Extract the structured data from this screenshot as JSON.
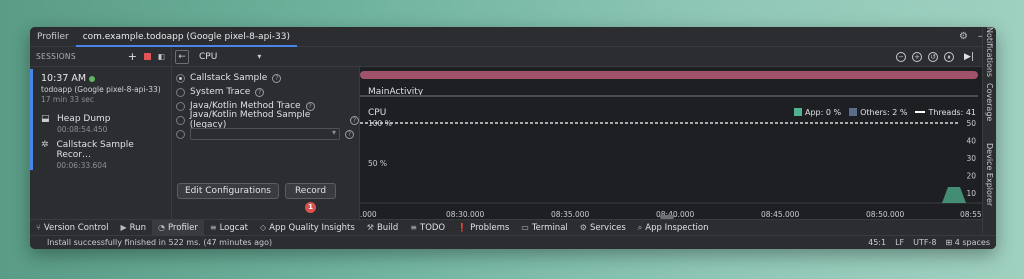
{
  "window": {
    "tabs": [
      "Profiler",
      "com.example.todoapp (Google pixel-8-api-33)"
    ],
    "right_icons": [
      "gear-icon",
      "minimize-icon"
    ]
  },
  "right_strip": [
    "Notifications",
    "Coverage",
    "Device Explorer"
  ],
  "sessions": {
    "header": "SESSIONS",
    "session": {
      "time": "10:37 AM",
      "device": "todoapp (Google pixel-8-api-33)",
      "duration": "17 min 33 sec"
    },
    "artifacts": [
      {
        "name": "Heap Dump",
        "time": "00:08:54.450"
      },
      {
        "name": "Callstack Sample Recor…",
        "time": "00:06:33.604"
      }
    ]
  },
  "toolbar": {
    "monitor": "CPU"
  },
  "config": {
    "options": [
      {
        "label": "Callstack Sample",
        "selected": true
      },
      {
        "label": "System Trace",
        "selected": false
      },
      {
        "label": "Java/Kotlin Method Trace",
        "selected": false
      },
      {
        "label": "Java/Kotlin Method Sample (legacy)",
        "selected": false
      }
    ],
    "edit_button": "Edit Configurations",
    "record_button": "Record",
    "record_badge": "1"
  },
  "timeline": {
    "activity": "MainActivity",
    "cpu_label": "CPU",
    "legend": {
      "app": "App: 0 %",
      "others": "Others: 2 %",
      "threads": "Threads: 41"
    },
    "colors": {
      "app": "#4fb38f",
      "others": "#5a6e8c",
      "activity": "#a1536b"
    }
  },
  "chart_data": {
    "type": "area",
    "title": "CPU",
    "y_left_ticks": [
      "100 %",
      "50 %"
    ],
    "y_right_ticks": [
      "50",
      "40",
      "30",
      "20",
      "10"
    ],
    "ylim": [
      0,
      100
    ],
    "x_ticks": [
      ".000",
      "08:30.000",
      "08:35.000",
      "08:40.000",
      "08:45.000",
      "08:50.000",
      "08:55"
    ],
    "series": [
      {
        "name": "App",
        "values": [
          0,
          0,
          0,
          0,
          0,
          0,
          0
        ]
      },
      {
        "name": "Others",
        "values": [
          2,
          2,
          2,
          2,
          2,
          2,
          2
        ]
      },
      {
        "name": "Threads",
        "values": [
          41,
          41,
          41,
          41,
          41,
          41,
          41
        ]
      }
    ]
  },
  "bottom_tools": [
    {
      "icon": "branch-icon",
      "label": "Version Control"
    },
    {
      "icon": "run-icon",
      "label": "Run"
    },
    {
      "icon": "gauge-icon",
      "label": "Profiler",
      "active": true
    },
    {
      "icon": "list-icon",
      "label": "Logcat"
    },
    {
      "icon": "diamond-icon",
      "label": "App Quality Insights"
    },
    {
      "icon": "hammer-icon",
      "label": "Build"
    },
    {
      "icon": "list-icon",
      "label": "TODO"
    },
    {
      "icon": "alert-icon",
      "label": "Problems"
    },
    {
      "icon": "terminal-icon",
      "label": "Terminal"
    },
    {
      "icon": "services-icon",
      "label": "Services"
    },
    {
      "icon": "inspect-icon",
      "label": "App Inspection"
    }
  ],
  "status": {
    "message": "Install successfully finished in 522 ms. (47 minutes ago)",
    "position": "45:1",
    "line_sep": "LF",
    "encoding": "UTF-8",
    "indent": "4 spaces"
  }
}
